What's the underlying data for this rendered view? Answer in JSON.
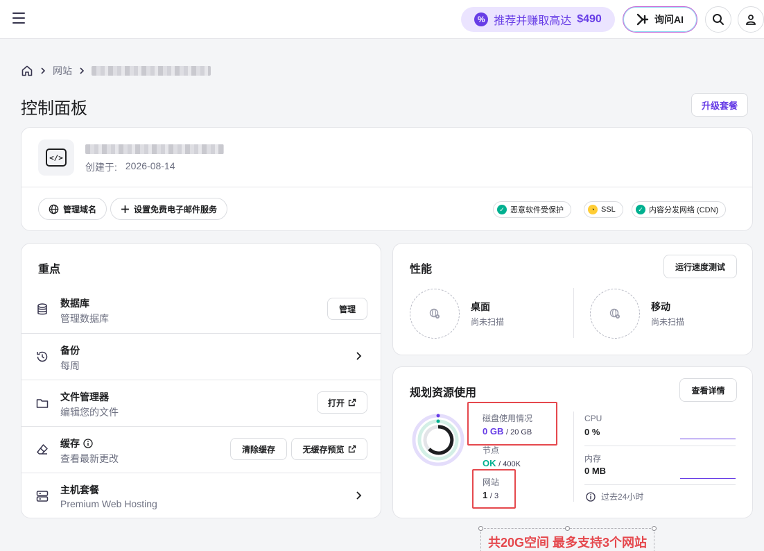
{
  "topbar": {
    "promo_text": "推荐并赚取高达",
    "promo_amount": "$490",
    "askai_label": "询问AI",
    "icons": [
      "menu-icon",
      "badge-percent-icon",
      "ai-sparkle-icon",
      "search-icon",
      "user-icon"
    ]
  },
  "breadcrumb": {
    "items": [
      "网站"
    ]
  },
  "page": {
    "title": "控制面板",
    "upgrade_label": "升级套餐"
  },
  "site": {
    "created_label": "创建于:",
    "created_date": "2026-08-14",
    "actions": [
      "管理域名",
      "设置免费电子邮件服务"
    ],
    "statuses": [
      {
        "label": "恶意软件受保护",
        "color": "#00b090"
      },
      {
        "label": "SSL",
        "color": "#ffcd35"
      },
      {
        "label": "内容分发网络 (CDN)",
        "color": "#00b090"
      }
    ]
  },
  "focus": {
    "title": "重点",
    "rows": [
      {
        "title": "数据库",
        "sub": "管理数据库",
        "action": "管理"
      },
      {
        "title": "备份",
        "sub": "每周"
      },
      {
        "title": "文件管理器",
        "sub": "编辑您的文件",
        "action": "打开"
      },
      {
        "title": "缓存",
        "sub": "查看最新更改",
        "action": "清除缓存",
        "action2": "无缓存预览"
      },
      {
        "title": "主机套餐",
        "sub": "Premium Web Hosting"
      }
    ]
  },
  "performance": {
    "title": "性能",
    "run_label": "运行速度测试",
    "desktop_label": "桌面",
    "desktop_status": "尚未扫描",
    "mobile_label": "移动",
    "mobile_status": "尚未扫描"
  },
  "resources": {
    "title": "规划资源使用",
    "detail_label": "查看详情",
    "disk_label": "磁盘使用情况",
    "disk_used": "0 GB",
    "disk_total": "/ 20 GB",
    "inodes_label": "节点",
    "inodes_used": "OK",
    "inodes_total": "/ 400K",
    "sites_label": "网站",
    "sites_used": "1",
    "sites_total": "/ 3",
    "cpu_label": "CPU",
    "cpu_value": "0 %",
    "mem_label": "内存",
    "mem_value": "0 MB",
    "period_label": "过去24小时"
  },
  "annotation": {
    "text": "共20G空间 最多支持3个网站"
  },
  "colors": {
    "accent": "#673de6",
    "success": "#00b090",
    "warning": "#ffcd35",
    "annotation_red": "#e5484d"
  }
}
